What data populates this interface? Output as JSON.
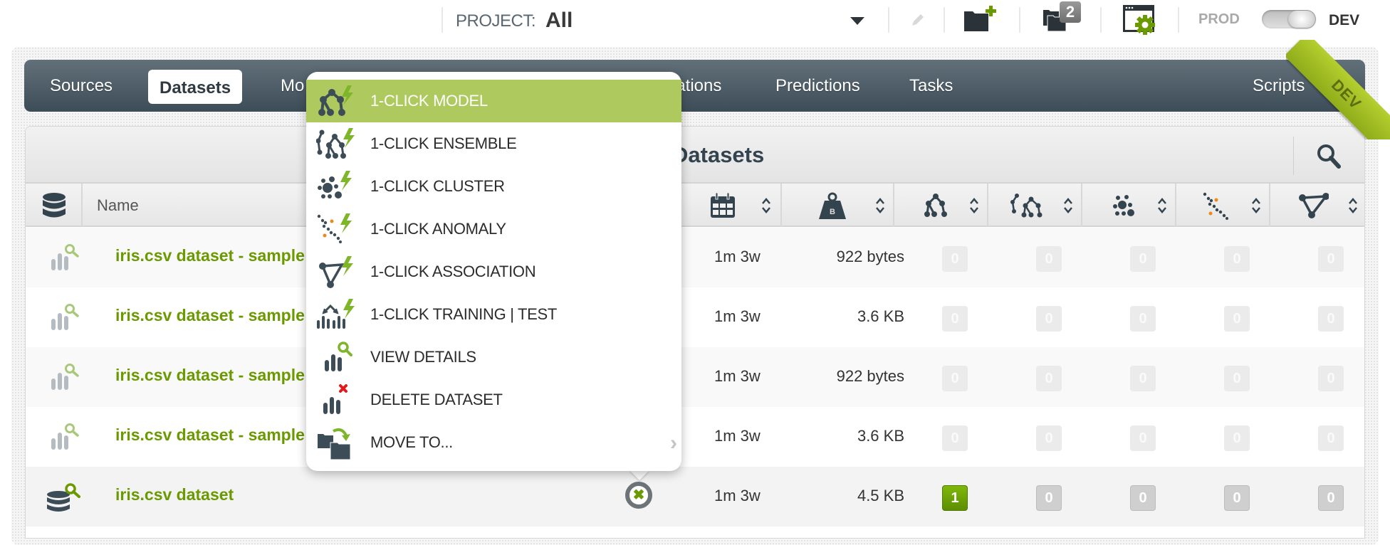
{
  "topbar": {
    "project_label": "PROJECT:",
    "project_value": "All",
    "icons": [
      "pencil-icon",
      "new-folder-icon",
      "folders-icon",
      "settings-window-icon"
    ],
    "folders_badge": "2",
    "env_prod": "PROD",
    "env_dev": "DEV",
    "env_toggle_state": "DEV"
  },
  "ribbon": {
    "label": "DEV",
    "color": "#a6c025"
  },
  "nav": {
    "items": [
      {
        "label": "Sources",
        "active": false
      },
      {
        "label": "Datasets",
        "active": true
      },
      {
        "label": "Mo",
        "active": false
      },
      {
        "label": "iations",
        "active": false
      },
      {
        "label": "Predictions",
        "active": false
      },
      {
        "label": "Tasks",
        "active": false
      }
    ],
    "scripts_label": "Scripts"
  },
  "table": {
    "title": "Datasets",
    "header": {
      "name": "Name",
      "column_icons": [
        "dataset-icon",
        "calendar-icon",
        "size-weight-icon",
        "model-icon",
        "ensemble-icon",
        "cluster-icon",
        "anomaly-icon",
        "association-icon"
      ]
    },
    "rows": [
      {
        "name": "iris.csv dataset - sample",
        "age": "1m 3w",
        "size": "922 bytes",
        "counts": [
          "0",
          "0",
          "0",
          "0",
          "0"
        ],
        "icon": "sample-dataset-icon"
      },
      {
        "name": "iris.csv dataset - sample",
        "age": "1m 3w",
        "size": "3.6 KB",
        "counts": [
          "0",
          "0",
          "0",
          "0",
          "0"
        ],
        "icon": "sample-dataset-icon"
      },
      {
        "name": "iris.csv dataset - sample",
        "age": "1m 3w",
        "size": "922 bytes",
        "counts": [
          "0",
          "0",
          "0",
          "0",
          "0"
        ],
        "icon": "sample-dataset-icon"
      },
      {
        "name": "iris.csv dataset - sample",
        "age": "1m 3w",
        "size": "3.6 KB",
        "counts": [
          "0",
          "0",
          "0",
          "0",
          "0"
        ],
        "icon": "sample-dataset-icon"
      },
      {
        "name": "iris.csv dataset",
        "age": "1m 3w",
        "size": "4.5 KB",
        "counts": [
          "1",
          "0",
          "0",
          "0",
          "0"
        ],
        "icon": "dataset-details-icon"
      }
    ]
  },
  "context_menu": {
    "items": [
      {
        "label": "1-CLICK MODEL",
        "icon": "one-click-model-icon",
        "highlighted": true
      },
      {
        "label": "1-CLICK ENSEMBLE",
        "icon": "one-click-ensemble-icon"
      },
      {
        "label": "1-CLICK CLUSTER",
        "icon": "one-click-cluster-icon"
      },
      {
        "label": "1-CLICK ANOMALY",
        "icon": "one-click-anomaly-icon"
      },
      {
        "label": "1-CLICK ASSOCIATION",
        "icon": "one-click-association-icon"
      },
      {
        "label": "1-CLICK TRAINING | TEST",
        "icon": "one-click-training-test-icon"
      },
      {
        "label": "VIEW DETAILS",
        "icon": "view-details-icon"
      },
      {
        "label": "DELETE DATASET",
        "icon": "delete-dataset-icon"
      },
      {
        "label": "MOVE TO...",
        "icon": "move-to-icon",
        "submenu": true
      }
    ],
    "highlight_color": "#aec95e"
  }
}
